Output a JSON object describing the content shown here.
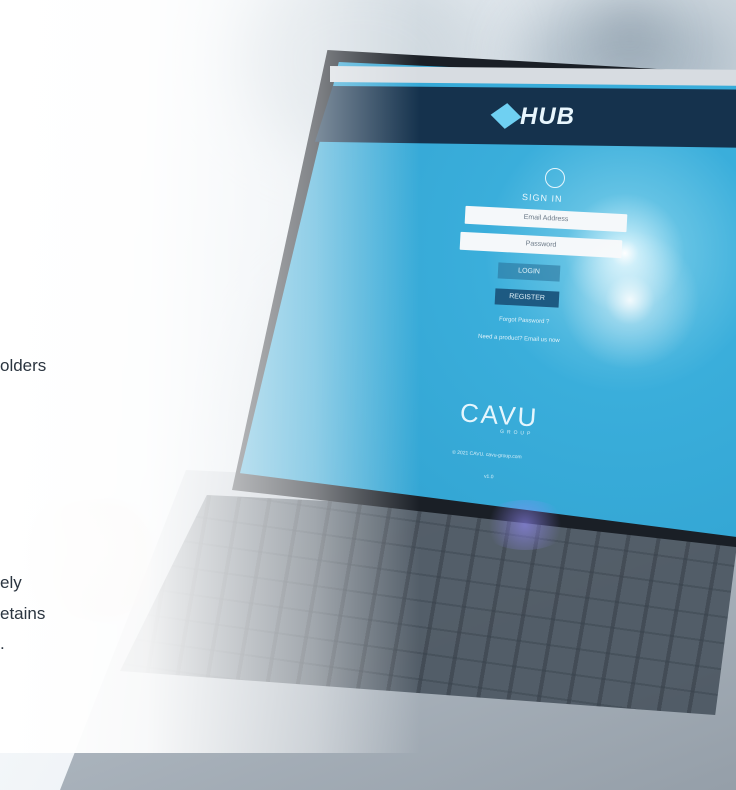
{
  "text_fragments": [
    "olders",
    "ely",
    "etains",
    "."
  ],
  "screen": {
    "logo_text": "HUB",
    "sign_in": "SIGN IN",
    "email_placeholder": "Email Address",
    "password_placeholder": "Password",
    "login_label": "LOGIN",
    "register_label": "REGISTER",
    "forgot_label": "Forgot Password ?",
    "help_label": "Need a product? Email us now",
    "brand": "CAVU",
    "brand_sub": "GROUP",
    "copyright": "© 2021 CAVU. cavu-group.com",
    "version": "v1.0"
  },
  "colors": {
    "screen_blue": "#3aaedb",
    "header_navy": "#15324d",
    "register_blue": "#1d5a82"
  }
}
